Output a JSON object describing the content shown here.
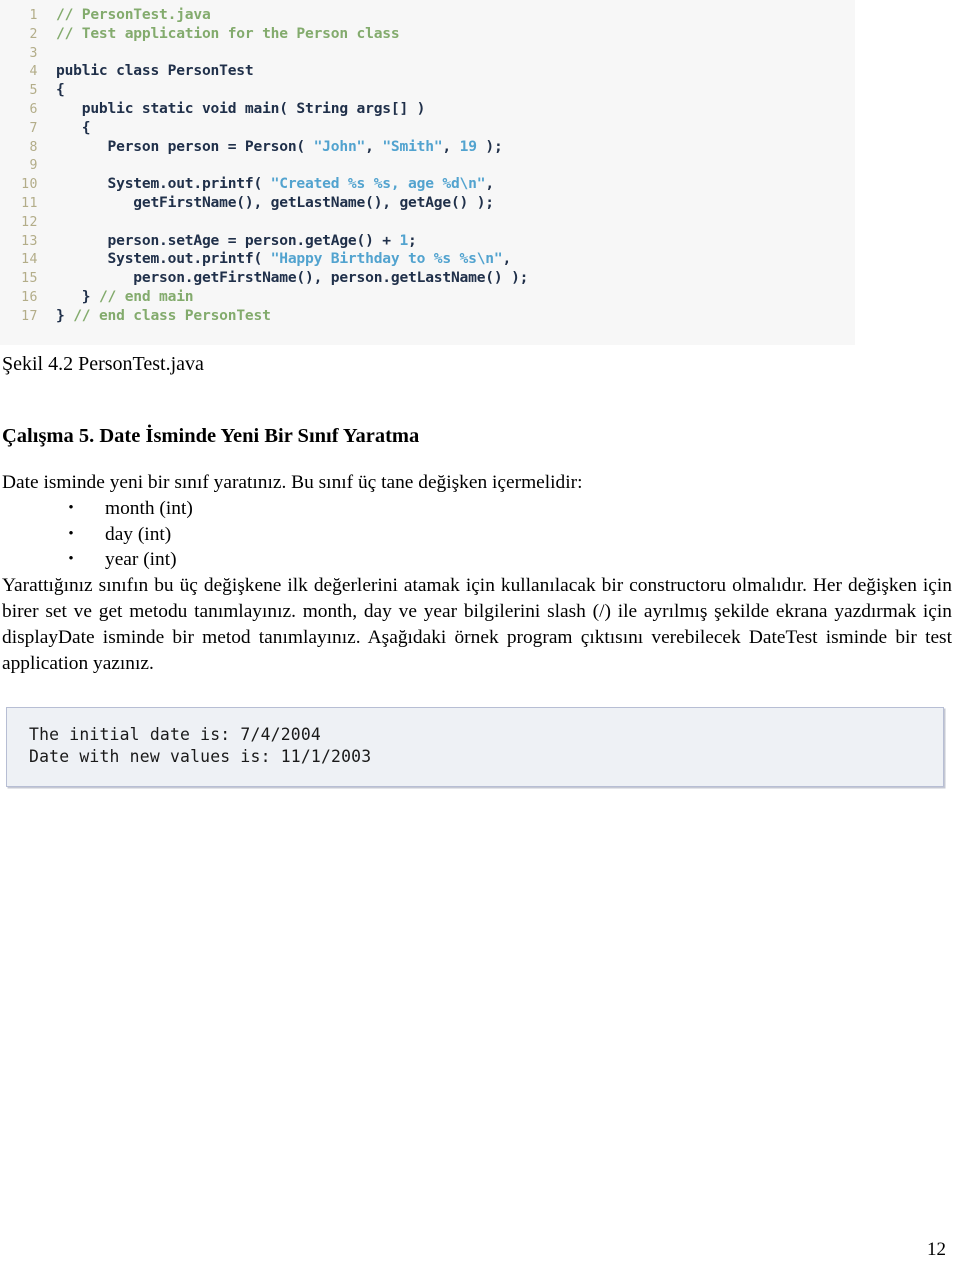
{
  "figure_code": {
    "name": "PersonTest.java listing",
    "colors": {
      "background": "#f7f7f7",
      "line_number": "#b3ad89",
      "code": "#20304a",
      "comment": "#83ab6d",
      "string": "#52a3cf",
      "number": "#52a3cf"
    },
    "lines": [
      {
        "n": "1",
        "tokens": [
          {
            "t": "// PersonTest.java",
            "c": "cm"
          }
        ]
      },
      {
        "n": "2",
        "tokens": [
          {
            "t": "// Test application for the Person class",
            "c": "cm"
          }
        ]
      },
      {
        "n": "3",
        "tokens": [
          {
            "t": "",
            "c": "pl"
          }
        ]
      },
      {
        "n": "4",
        "tokens": [
          {
            "t": "public class PersonTest",
            "c": "pl"
          }
        ]
      },
      {
        "n": "5",
        "tokens": [
          {
            "t": "{",
            "c": "pl"
          }
        ]
      },
      {
        "n": "6",
        "tokens": [
          {
            "t": "   public static void main( String args[] )",
            "c": "pl"
          }
        ]
      },
      {
        "n": "7",
        "tokens": [
          {
            "t": "   {",
            "c": "pl"
          }
        ]
      },
      {
        "n": "8",
        "tokens": [
          {
            "t": "      Person person = Person( ",
            "c": "pl"
          },
          {
            "t": "\"John\"",
            "c": "str"
          },
          {
            "t": ", ",
            "c": "pl"
          },
          {
            "t": "\"Smith\"",
            "c": "str"
          },
          {
            "t": ", ",
            "c": "pl"
          },
          {
            "t": "19",
            "c": "num"
          },
          {
            "t": " );",
            "c": "pl"
          }
        ]
      },
      {
        "n": "9",
        "tokens": [
          {
            "t": "",
            "c": "pl"
          }
        ]
      },
      {
        "n": "10",
        "tokens": [
          {
            "t": "      System.out.printf( ",
            "c": "pl"
          },
          {
            "t": "\"Created %s %s, age %d\\n\"",
            "c": "str"
          },
          {
            "t": ",",
            "c": "pl"
          }
        ]
      },
      {
        "n": "11",
        "tokens": [
          {
            "t": "         getFirstName(), getLastName(), getAge() );",
            "c": "pl"
          }
        ]
      },
      {
        "n": "12",
        "tokens": [
          {
            "t": "",
            "c": "pl"
          }
        ]
      },
      {
        "n": "13",
        "tokens": [
          {
            "t": "      person.setAge = person.getAge() + ",
            "c": "pl"
          },
          {
            "t": "1",
            "c": "num"
          },
          {
            "t": ";",
            "c": "pl"
          }
        ]
      },
      {
        "n": "14",
        "tokens": [
          {
            "t": "      System.out.printf( ",
            "c": "pl"
          },
          {
            "t": "\"Happy Birthday to %s %s\\n\"",
            "c": "str"
          },
          {
            "t": ",",
            "c": "pl"
          }
        ]
      },
      {
        "n": "15",
        "tokens": [
          {
            "t": "         person.getFirstName(), person.getLastName() );",
            "c": "pl"
          }
        ]
      },
      {
        "n": "16",
        "tokens": [
          {
            "t": "   } ",
            "c": "pl"
          },
          {
            "t": "// end main",
            "c": "cm"
          }
        ]
      },
      {
        "n": "17",
        "tokens": [
          {
            "t": "} ",
            "c": "pl"
          },
          {
            "t": "// end class PersonTest",
            "c": "cm"
          }
        ]
      }
    ]
  },
  "figure_caption": "Şekil 4.2 PersonTest.java",
  "section_heading": "Çalışma 5. Date İsminde Yeni Bir Sınıf Yaratma",
  "intro_text": "Date isminde yeni bir sınıf yaratınız. Bu sınıf üç tane değişken içermelidir:",
  "bullets": [
    {
      "marker": "•",
      "label": "month (int)"
    },
    {
      "marker": "•",
      "label": "day (int)"
    },
    {
      "marker": "•",
      "label": "year (int)"
    }
  ],
  "paragraph": "Yarattığınız sınıfın bu üç değişkene ilk değerlerini atamak için kullanılacak bir constructoru olmalıdır. Her değişken için birer set ve get metodu tanımlayınız. month, day ve year bilgilerini slash (/) ile ayrılmış şekilde ekrana yazdırmak için displayDate isminde bir metod tanımlayınız. Aşağıdaki örnek program çıktısını verebilecek DateTest isminde bir test application yazınız.",
  "figure_output": {
    "name": "sample program output",
    "colors": {
      "background": "#eef1f5",
      "border": "#b7bed4"
    },
    "lines": [
      "The initial date is: 7/4/2004",
      "Date with new values is: 11/1/2003"
    ]
  },
  "page_number": "12"
}
